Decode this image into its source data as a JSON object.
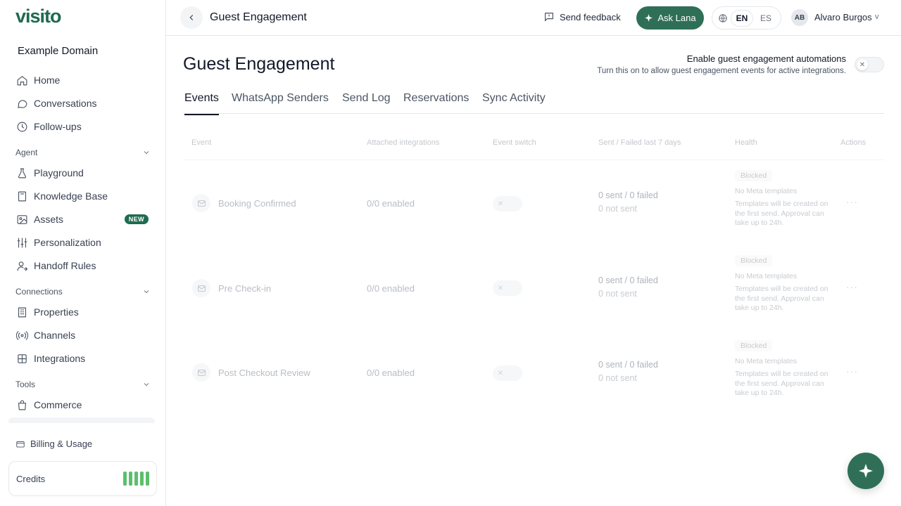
{
  "brand": {
    "logo": "visito",
    "domain": "Example Domain",
    "accent": "#2f6f58"
  },
  "sidebar": {
    "items_top": [
      {
        "label": "Home",
        "icon": "home-icon"
      },
      {
        "label": "Conversations",
        "icon": "chat-bubble-icon"
      },
      {
        "label": "Follow-ups",
        "icon": "clock-icon"
      }
    ],
    "sections": {
      "agent": "Agent",
      "connections": "Connections",
      "tools": "Tools"
    },
    "agent_items": [
      {
        "label": "Playground",
        "icon": "flask-icon"
      },
      {
        "label": "Knowledge Base",
        "icon": "book-icon"
      },
      {
        "label": "Assets",
        "icon": "image-icon",
        "badge": "NEW"
      },
      {
        "label": "Personalization",
        "icon": "sliders-icon"
      },
      {
        "label": "Handoff Rules",
        "icon": "user-handoff-icon"
      }
    ],
    "connection_items": [
      {
        "label": "Properties",
        "icon": "building-icon"
      },
      {
        "label": "Channels",
        "icon": "signal-icon"
      },
      {
        "label": "Integrations",
        "icon": "puzzle-icon"
      }
    ],
    "tool_items": [
      {
        "label": "Commerce",
        "icon": "shopping-bag-icon"
      }
    ],
    "billing": "Billing & Usage",
    "credits": "Credits"
  },
  "topbar": {
    "title": "Guest Engagement",
    "feedback": "Send feedback",
    "ask": "Ask Lana",
    "lang_en": "EN",
    "lang_es": "ES",
    "avatar": "AB",
    "user": "Alvaro Burgos",
    "caret": "v"
  },
  "main": {
    "title": "Guest Engagement",
    "automation_title": "Enable guest engagement automations",
    "automation_desc": "Turn this on to allow guest engagement events for active integrations.",
    "tabs": [
      "Events",
      "WhatsApp Senders",
      "Send Log",
      "Reservations",
      "Sync Activity"
    ],
    "columns": [
      "Event",
      "Attached integrations",
      "Event switch",
      "Sent / Failed last 7 days",
      "Health",
      "Actions"
    ],
    "rows": [
      {
        "event": "Booking Confirmed",
        "integrations": "0/0 enabled",
        "sent": "0 sent / 0 failed",
        "not_sent": "0 not sent",
        "health": "Blocked",
        "meta": "No Meta templates",
        "note": "Templates will be created on the first send. Approval can take up to 24h."
      },
      {
        "event": "Pre Check-in",
        "integrations": "0/0 enabled",
        "sent": "0 sent / 0 failed",
        "not_sent": "0 not sent",
        "health": "Blocked",
        "meta": "No Meta templates",
        "note": "Templates will be created on the first send. Approval can take up to 24h."
      },
      {
        "event": "Post Checkout Review",
        "integrations": "0/0 enabled",
        "sent": "0 sent / 0 failed",
        "not_sent": "0 not sent",
        "health": "Blocked",
        "meta": "No Meta templates",
        "note": "Templates will be created on the first send. Approval can take up to 24h."
      }
    ]
  }
}
